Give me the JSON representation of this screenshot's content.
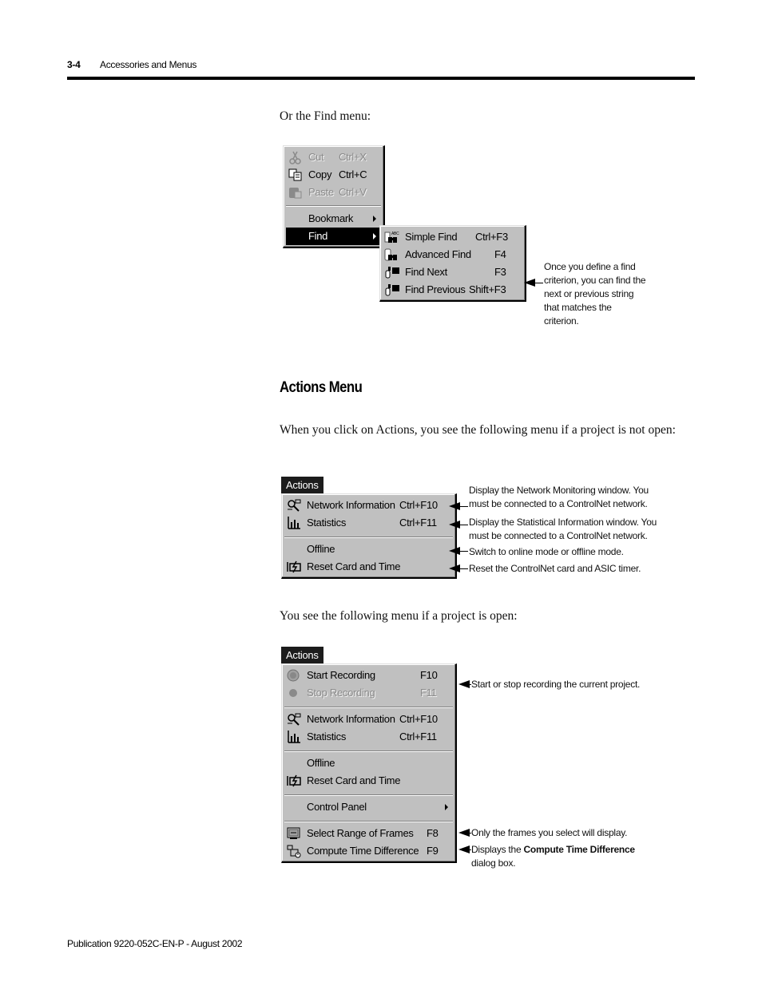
{
  "header": {
    "page_number": "3-4",
    "chapter_title": "Accessories and Menus"
  },
  "intro_find": "Or the Find menu:",
  "edit_menu": {
    "items": [
      {
        "label": "Cut",
        "shortcut": "Ctrl+X",
        "icon": "scissors-icon",
        "disabled": true
      },
      {
        "label": "Copy",
        "shortcut": "Ctrl+C",
        "icon": "copy-icon",
        "disabled": false
      },
      {
        "label": "Paste",
        "shortcut": "Ctrl+V",
        "icon": "paste-icon",
        "disabled": true
      },
      {
        "label": "Bookmark",
        "submenu": true
      },
      {
        "label": "Find",
        "submenu": true,
        "selected": true
      }
    ]
  },
  "find_submenu": {
    "items": [
      {
        "label": "Simple Find",
        "shortcut": "Ctrl+F3",
        "icon": "simple-find-binoculars-icon"
      },
      {
        "label": "Advanced Find",
        "shortcut": "F4",
        "icon": "advanced-find-binoculars-icon"
      },
      {
        "label": "Find Next",
        "shortcut": "F3",
        "icon": "find-next-binoculars-icon"
      },
      {
        "label": "Find Previous",
        "shortcut": "Shift+F3",
        "icon": "find-previous-binoculars-icon"
      }
    ],
    "callout": "Once you define a find criterion, you can find the next or previous string that matches the criterion."
  },
  "section": {
    "heading": "Actions Menu",
    "para_not_open": "When you click on Actions, you see the following menu if a project is not open:",
    "para_open": "You see the following menu if a project is open:"
  },
  "actions_menu_closed": {
    "title": "Actions",
    "items": [
      {
        "label": "Network Information",
        "shortcut": "Ctrl+F10",
        "icon": "network-info-icon"
      },
      {
        "label": "Statistics",
        "shortcut": "Ctrl+F11",
        "icon": "statistics-chart-icon"
      },
      {
        "label": "Offline",
        "shortcut": ""
      },
      {
        "label": "Reset Card and Time",
        "shortcut": "",
        "icon": "reset-card-icon"
      }
    ],
    "callouts": [
      "Display the Network Monitoring window. You must be connected to a ControlNet network.",
      "Display the Statistical Information window. You must be connected to a ControlNet network.",
      "Switch to online mode or offline mode.",
      "Reset the ControlNet card and ASIC timer."
    ]
  },
  "actions_menu_open": {
    "title": "Actions",
    "items": [
      {
        "label": "Start Recording",
        "shortcut": "F10",
        "icon": "record-icon"
      },
      {
        "label": "Stop Recording",
        "shortcut": "F11",
        "icon": "stop-record-icon",
        "disabled": true
      },
      {
        "label": "Network Information",
        "shortcut": "Ctrl+F10",
        "icon": "network-info-icon"
      },
      {
        "label": "Statistics",
        "shortcut": "Ctrl+F11",
        "icon": "statistics-chart-icon"
      },
      {
        "label": "Offline",
        "shortcut": ""
      },
      {
        "label": "Reset Card and Time",
        "shortcut": "",
        "icon": "reset-card-icon"
      },
      {
        "label": "Control Panel",
        "submenu": true
      },
      {
        "label": "Select Range of Frames",
        "shortcut": "F8",
        "icon": "select-frames-icon"
      },
      {
        "label": "Compute Time Difference",
        "shortcut": "F9",
        "icon": "compute-time-icon"
      }
    ],
    "callouts": {
      "recording": "Start or stop recording the current project.",
      "frames": "Only the frames you select will display.",
      "compute_prefix": "Displays the ",
      "compute_bold": "Compute Time Difference",
      "compute_suffix": " dialog box."
    }
  },
  "footer": {
    "publication": "Publication 9220-052C-EN-P - August 2002"
  }
}
